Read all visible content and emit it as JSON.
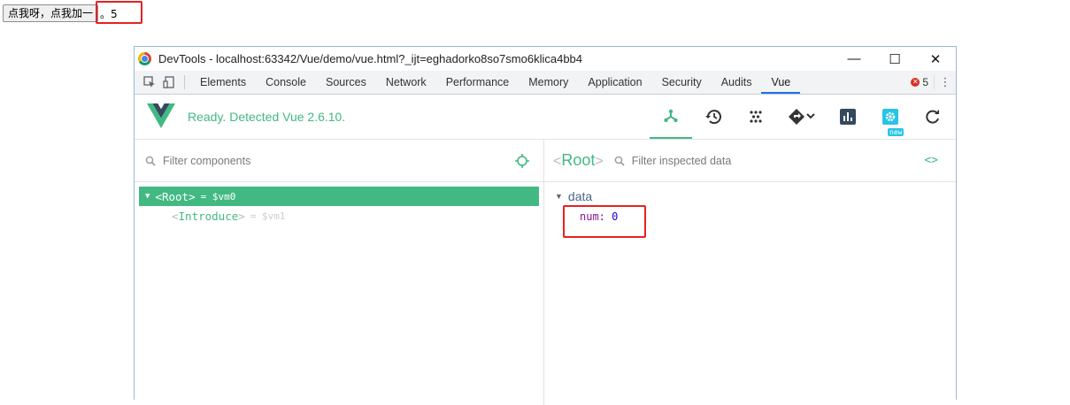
{
  "page": {
    "button_label": "点我呀，点我加一",
    "display_text": "。5"
  },
  "window": {
    "title": "DevTools - localhost:63342/Vue/demo/vue.html?_ijt=eghadorko8so7smo6klica4bb4",
    "controls": [
      "minimize-icon",
      "maximize-icon",
      "close-icon"
    ]
  },
  "tabs": [
    "Elements",
    "Console",
    "Sources",
    "Network",
    "Performance",
    "Memory",
    "Application",
    "Security",
    "Audits",
    "Vue"
  ],
  "active_tab": "Vue",
  "error_count": "5",
  "vue_bar": {
    "status": "Ready. Detected Vue 2.6.10.",
    "accent": "#42b983",
    "buttons": [
      "components-icon",
      "history-icon",
      "vuex-icon",
      "events-icon",
      "performance-icon",
      "settings-icon",
      "refresh-icon"
    ],
    "new_badge": "new"
  },
  "left_pane": {
    "filter_placeholder": "Filter components",
    "tree": [
      {
        "open": "<",
        "name": "Root",
        "close": ">",
        "eq": "= $vm0",
        "selected": true
      },
      {
        "open": "<",
        "name": "Introduce",
        "close": ">",
        "eq": "= $vm1",
        "selected": false
      }
    ]
  },
  "right_pane": {
    "crumb_open": "<",
    "crumb_name": "Root",
    "crumb_close": ">",
    "filter_placeholder": "Filter inspected data",
    "section": "data",
    "prop_key": "num:",
    "prop_value": "0"
  }
}
